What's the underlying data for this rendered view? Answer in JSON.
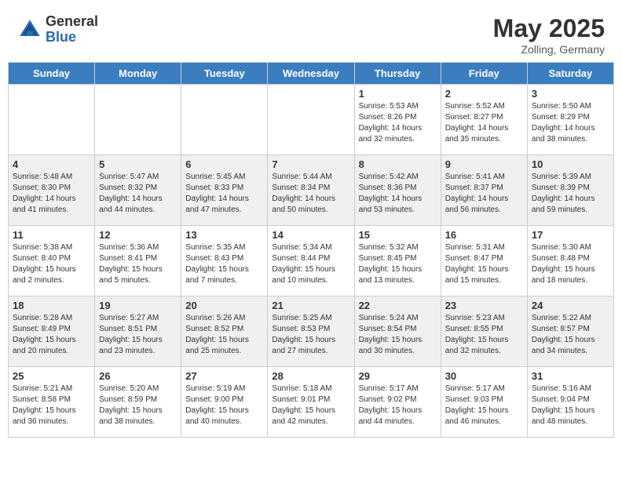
{
  "header": {
    "logo_general": "General",
    "logo_blue": "Blue",
    "month_title": "May 2025",
    "location": "Zolling, Germany"
  },
  "weekdays": [
    "Sunday",
    "Monday",
    "Tuesday",
    "Wednesday",
    "Thursday",
    "Friday",
    "Saturday"
  ],
  "weeks": [
    [
      {
        "day": "",
        "info": ""
      },
      {
        "day": "",
        "info": ""
      },
      {
        "day": "",
        "info": ""
      },
      {
        "day": "",
        "info": ""
      },
      {
        "day": "1",
        "info": "Sunrise: 5:53 AM\nSunset: 8:26 PM\nDaylight: 14 hours and 32 minutes."
      },
      {
        "day": "2",
        "info": "Sunrise: 5:52 AM\nSunset: 8:27 PM\nDaylight: 14 hours and 35 minutes."
      },
      {
        "day": "3",
        "info": "Sunrise: 5:50 AM\nSunset: 8:29 PM\nDaylight: 14 hours and 38 minutes."
      }
    ],
    [
      {
        "day": "4",
        "info": "Sunrise: 5:48 AM\nSunset: 8:30 PM\nDaylight: 14 hours and 41 minutes."
      },
      {
        "day": "5",
        "info": "Sunrise: 5:47 AM\nSunset: 8:32 PM\nDaylight: 14 hours and 44 minutes."
      },
      {
        "day": "6",
        "info": "Sunrise: 5:45 AM\nSunset: 8:33 PM\nDaylight: 14 hours and 47 minutes."
      },
      {
        "day": "7",
        "info": "Sunrise: 5:44 AM\nSunset: 8:34 PM\nDaylight: 14 hours and 50 minutes."
      },
      {
        "day": "8",
        "info": "Sunrise: 5:42 AM\nSunset: 8:36 PM\nDaylight: 14 hours and 53 minutes."
      },
      {
        "day": "9",
        "info": "Sunrise: 5:41 AM\nSunset: 8:37 PM\nDaylight: 14 hours and 56 minutes."
      },
      {
        "day": "10",
        "info": "Sunrise: 5:39 AM\nSunset: 8:39 PM\nDaylight: 14 hours and 59 minutes."
      }
    ],
    [
      {
        "day": "11",
        "info": "Sunrise: 5:38 AM\nSunset: 8:40 PM\nDaylight: 15 hours and 2 minutes."
      },
      {
        "day": "12",
        "info": "Sunrise: 5:36 AM\nSunset: 8:41 PM\nDaylight: 15 hours and 5 minutes."
      },
      {
        "day": "13",
        "info": "Sunrise: 5:35 AM\nSunset: 8:43 PM\nDaylight: 15 hours and 7 minutes."
      },
      {
        "day": "14",
        "info": "Sunrise: 5:34 AM\nSunset: 8:44 PM\nDaylight: 15 hours and 10 minutes."
      },
      {
        "day": "15",
        "info": "Sunrise: 5:32 AM\nSunset: 8:45 PM\nDaylight: 15 hours and 13 minutes."
      },
      {
        "day": "16",
        "info": "Sunrise: 5:31 AM\nSunset: 8:47 PM\nDaylight: 15 hours and 15 minutes."
      },
      {
        "day": "17",
        "info": "Sunrise: 5:30 AM\nSunset: 8:48 PM\nDaylight: 15 hours and 18 minutes."
      }
    ],
    [
      {
        "day": "18",
        "info": "Sunrise: 5:28 AM\nSunset: 8:49 PM\nDaylight: 15 hours and 20 minutes."
      },
      {
        "day": "19",
        "info": "Sunrise: 5:27 AM\nSunset: 8:51 PM\nDaylight: 15 hours and 23 minutes."
      },
      {
        "day": "20",
        "info": "Sunrise: 5:26 AM\nSunset: 8:52 PM\nDaylight: 15 hours and 25 minutes."
      },
      {
        "day": "21",
        "info": "Sunrise: 5:25 AM\nSunset: 8:53 PM\nDaylight: 15 hours and 27 minutes."
      },
      {
        "day": "22",
        "info": "Sunrise: 5:24 AM\nSunset: 8:54 PM\nDaylight: 15 hours and 30 minutes."
      },
      {
        "day": "23",
        "info": "Sunrise: 5:23 AM\nSunset: 8:55 PM\nDaylight: 15 hours and 32 minutes."
      },
      {
        "day": "24",
        "info": "Sunrise: 5:22 AM\nSunset: 8:57 PM\nDaylight: 15 hours and 34 minutes."
      }
    ],
    [
      {
        "day": "25",
        "info": "Sunrise: 5:21 AM\nSunset: 8:58 PM\nDaylight: 15 hours and 36 minutes."
      },
      {
        "day": "26",
        "info": "Sunrise: 5:20 AM\nSunset: 8:59 PM\nDaylight: 15 hours and 38 minutes."
      },
      {
        "day": "27",
        "info": "Sunrise: 5:19 AM\nSunset: 9:00 PM\nDaylight: 15 hours and 40 minutes."
      },
      {
        "day": "28",
        "info": "Sunrise: 5:18 AM\nSunset: 9:01 PM\nDaylight: 15 hours and 42 minutes."
      },
      {
        "day": "29",
        "info": "Sunrise: 5:17 AM\nSunset: 9:02 PM\nDaylight: 15 hours and 44 minutes."
      },
      {
        "day": "30",
        "info": "Sunrise: 5:17 AM\nSunset: 9:03 PM\nDaylight: 15 hours and 46 minutes."
      },
      {
        "day": "31",
        "info": "Sunrise: 5:16 AM\nSunset: 9:04 PM\nDaylight: 15 hours and 48 minutes."
      }
    ]
  ]
}
